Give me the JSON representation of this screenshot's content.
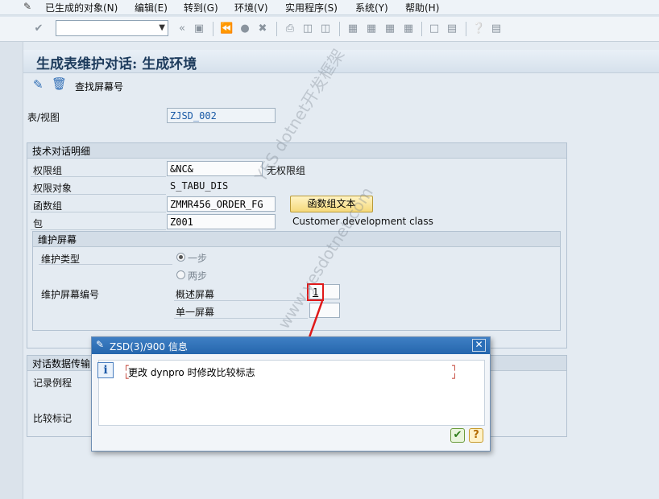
{
  "menu": {
    "items": [
      "已生成的对象(N)",
      "编辑(E)",
      "转到(G)",
      "环境(V)",
      "实用程序(S)",
      "系统(Y)",
      "帮助(H)"
    ]
  },
  "toolbar": {
    "command_value": ""
  },
  "screen": {
    "title": "生成表维护对话: 生成环境",
    "find_screen_label": "查找屏幕号"
  },
  "table_view": {
    "label": "表/视图",
    "value": "ZJSD_002"
  },
  "tech_details": {
    "header": "技术对话明细",
    "auth_group_label": "权限组",
    "auth_group_value": "&NC&",
    "auth_group_text": "无权限组",
    "auth_object_label": "权限对象",
    "auth_object_value": "S_TABU_DIS",
    "function_group_label": "函数组",
    "function_group_value": "ZMMR456_ORDER_FG",
    "function_group_text_button": "函数组文本",
    "package_label": "包",
    "package_value": "Z001",
    "package_text": "Customer development class"
  },
  "maint_screen": {
    "header": "维护屏幕",
    "type_label": "维护类型",
    "option_one_step": "一步",
    "option_two_step": "两步",
    "number_label": "维护屏幕编号",
    "overview_label": "概述屏幕",
    "overview_value": "1",
    "single_label": "单一屏幕",
    "single_value": ""
  },
  "dialog_data": {
    "header": "对话数据传输",
    "record_routine_label": "记录例程",
    "compare_flag_label": "比较标记"
  },
  "dialog": {
    "title": "ZSD(3)/900 信息",
    "message": "更改 dynpro 时修改比较标志"
  },
  "watermark": {
    "line1": "YES dotnet开发框架",
    "line2": "www.yesdotnet.com"
  },
  "colors": {
    "title_text": "#1d3b5c",
    "dialog_title_bg": "#2566ad",
    "highlight_box": "#e01818"
  }
}
